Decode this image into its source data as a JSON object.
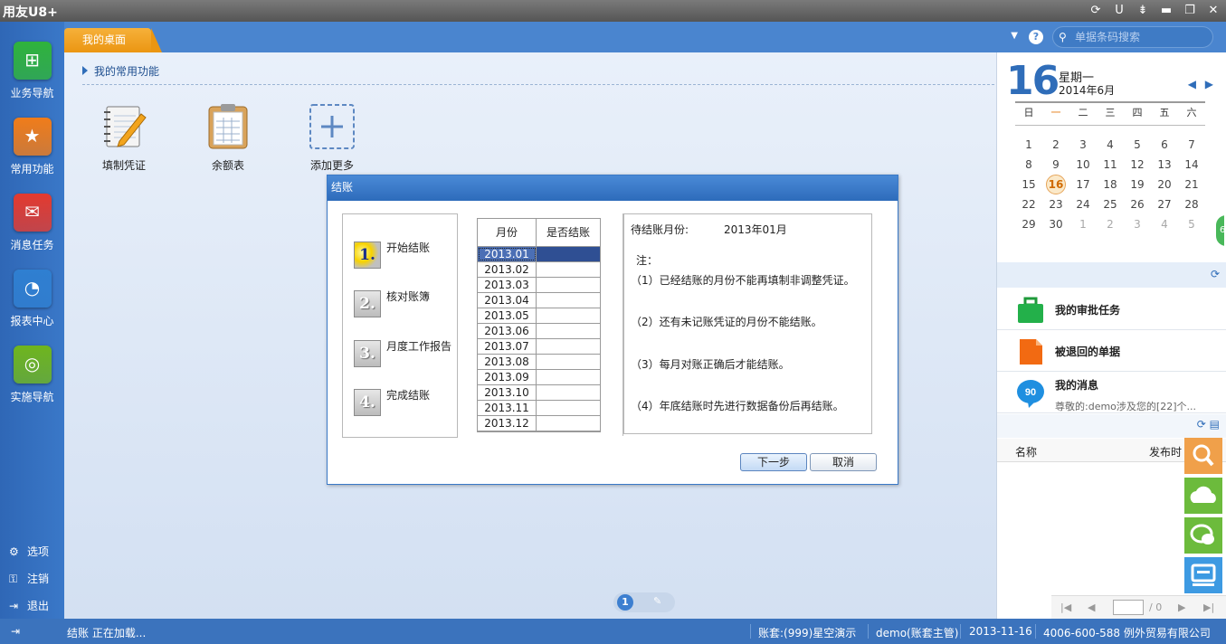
{
  "app": {
    "title": "用友U8+"
  },
  "window_controls": [
    {
      "name": "refresh-icon",
      "glyph": "⟳"
    },
    {
      "name": "u-icon",
      "glyph": "U"
    },
    {
      "name": "menu-icon",
      "glyph": "⇟"
    },
    {
      "name": "minimize-icon",
      "glyph": "▬"
    },
    {
      "name": "restore-icon",
      "glyph": "❐"
    },
    {
      "name": "close-icon",
      "glyph": "✕"
    }
  ],
  "nav": {
    "items": [
      {
        "label": "业务导航",
        "icon": "business-nav-icon",
        "color": "#2fb33c"
      },
      {
        "label": "常用功能",
        "icon": "star-icon",
        "color": "#f07c1a"
      },
      {
        "label": "消息任务",
        "icon": "message-icon",
        "color": "#e33a2f"
      },
      {
        "label": "报表中心",
        "icon": "report-icon",
        "color": "#2f7fd1"
      },
      {
        "label": "实施导航",
        "icon": "compass-icon",
        "color": "#6fb51e"
      }
    ],
    "bottom": [
      {
        "label": "选项",
        "glyph": "⚙"
      },
      {
        "label": "注销",
        "glyph": "⚿"
      },
      {
        "label": "退出",
        "glyph": "⇥"
      }
    ]
  },
  "topbar": {
    "tab": "我的桌面",
    "search_placeholder": "单据条码搜索",
    "help": "?"
  },
  "desk": {
    "section": "我的常用功能",
    "shortcuts": [
      {
        "label": "填制凭证"
      },
      {
        "label": "余额表"
      },
      {
        "label": "添加更多"
      }
    ],
    "page": "1"
  },
  "dialog": {
    "title": "结账",
    "steps": [
      {
        "num": "1.",
        "label": "开始结账",
        "active": true
      },
      {
        "num": "2.",
        "label": "核对账簿"
      },
      {
        "num": "3.",
        "label": "月度工作报告"
      },
      {
        "num": "4.",
        "label": "完成结账"
      }
    ],
    "table": {
      "headers": [
        "月份",
        "是否结账"
      ],
      "rows": [
        "2013.01",
        "2013.02",
        "2013.03",
        "2013.04",
        "2013.05",
        "2013.06",
        "2013.07",
        "2013.08",
        "2013.09",
        "2013.10",
        "2013.11",
        "2013.12"
      ],
      "selected": "2013.01"
    },
    "pending_label": "待结账月份:",
    "pending_value": "2013年01月",
    "note_title": "注：",
    "notes": [
      "（1）已经结账的月份不能再填制非调整凭证。",
      "（2）还有未记账凭证的月份不能结账。",
      "（3）每月对账正确后才能结账。",
      "（4）年底结账时先进行数据备份后再结账。"
    ],
    "buttons": {
      "next": "下一步",
      "cancel": "取消"
    }
  },
  "calendar": {
    "day": "16",
    "weekday": "星期一",
    "month": "2014年6月",
    "weekdays": [
      "日",
      "一",
      "二",
      "三",
      "四",
      "五",
      "六"
    ],
    "weeks": [
      [
        {
          "d": "1"
        },
        {
          "d": "2"
        },
        {
          "d": "3"
        },
        {
          "d": "4"
        },
        {
          "d": "5"
        },
        {
          "d": "6"
        },
        {
          "d": "7"
        }
      ],
      [
        {
          "d": "8"
        },
        {
          "d": "9"
        },
        {
          "d": "10"
        },
        {
          "d": "11"
        },
        {
          "d": "12"
        },
        {
          "d": "13"
        },
        {
          "d": "14"
        }
      ],
      [
        {
          "d": "15"
        },
        {
          "d": "16",
          "today": true
        },
        {
          "d": "17"
        },
        {
          "d": "18"
        },
        {
          "d": "19"
        },
        {
          "d": "20"
        },
        {
          "d": "21"
        }
      ],
      [
        {
          "d": "22"
        },
        {
          "d": "23"
        },
        {
          "d": "24"
        },
        {
          "d": "25"
        },
        {
          "d": "26"
        },
        {
          "d": "27"
        },
        {
          "d": "28"
        }
      ],
      [
        {
          "d": "29"
        },
        {
          "d": "30"
        },
        {
          "d": "1",
          "o": true
        },
        {
          "d": "2",
          "o": true
        },
        {
          "d": "3",
          "o": true
        },
        {
          "d": "4",
          "o": true
        },
        {
          "d": "5",
          "o": true
        }
      ]
    ]
  },
  "tasks": [
    {
      "label": "我的审批任务",
      "icon": "briefcase-icon"
    },
    {
      "label": "被退回的单据",
      "icon": "document-icon"
    },
    {
      "label": "我的消息",
      "sub": "尊敬的:demo涉及您的[22]个...",
      "badge": "90",
      "icon": "chat-bubble-icon"
    }
  ],
  "list": {
    "col1": "名称",
    "col2": "发布时",
    "page_total": "/ 0"
  },
  "side_edge": "6",
  "status": {
    "left": "结账 正在加载...",
    "account": "账套:(999)星空演示",
    "user": "demo(账套主管)",
    "date": "2013-11-16",
    "company": "4006-600-588 例外贸易有限公司"
  },
  "colors": {
    "accent": "#2f6db9",
    "tab": "#f0a223",
    "selected_row": "#4b6fb5"
  }
}
